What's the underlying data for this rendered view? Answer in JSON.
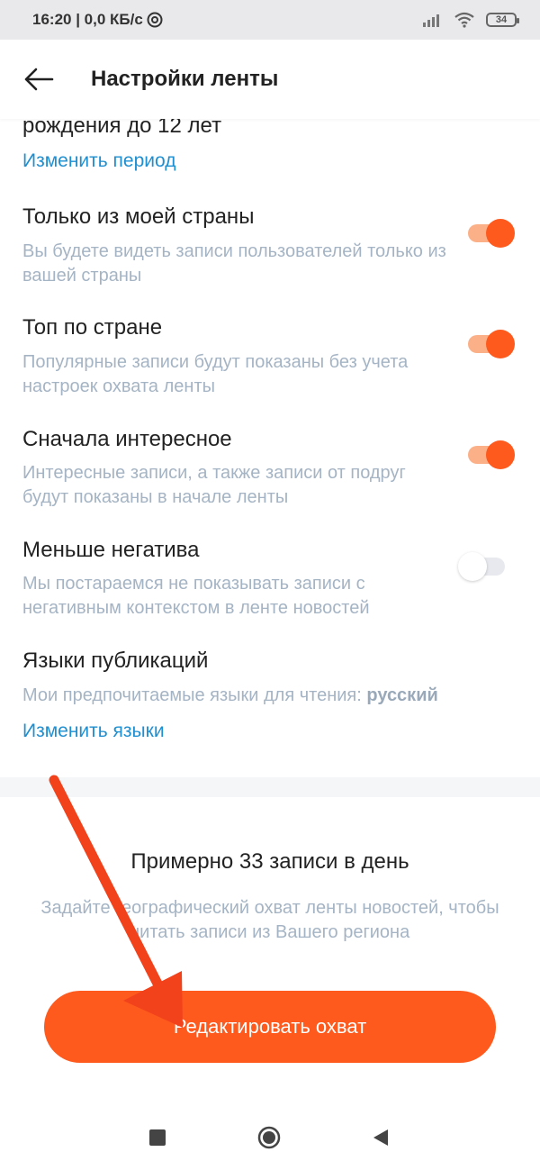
{
  "status_bar": {
    "time_info": "16:20 | 0,0 КБ/с",
    "battery": "34"
  },
  "header": {
    "title": "Настройки ленты"
  },
  "content": {
    "partial_text": "рождения до 12 лет",
    "change_period_link": "Изменить период",
    "settings": [
      {
        "title": "Только из моей страны",
        "description": "Вы будете видеть записи пользователей только из вашей страны",
        "enabled": true
      },
      {
        "title": "Топ по стране",
        "description": "Популярные записи будут показаны без учета настроек охвата ленты",
        "enabled": true
      },
      {
        "title": "Сначала интересное",
        "description": "Интересные записи, а также записи от подруг будут показаны в начале ленты",
        "enabled": true
      },
      {
        "title": "Меньше негатива",
        "description": "Мы постараемся не показывать записи с негативным контекстом в ленте новостей",
        "enabled": false
      }
    ],
    "languages": {
      "title": "Языки публикаций",
      "description_prefix": "Мои предпочитаемые языки для чтения: ",
      "selected_language": "русский",
      "change_link": "Изменить языки"
    }
  },
  "coverage": {
    "estimate": "Примерно 33 записи в день",
    "hint": "Задайте географический охват ленты новостей, чтобы читать записи из Вашего региона",
    "button_label": "Редактировать охват"
  },
  "colors": {
    "accent": "#fe5a1e",
    "link": "#1f8fd1",
    "secondary_text": "#a5b4c4",
    "annotation_arrow": "#f1421c"
  },
  "icons": {
    "back": "arrow-left-icon",
    "nav_recent": "square-icon",
    "nav_home": "circle-icon",
    "nav_back": "triangle-left-icon"
  }
}
